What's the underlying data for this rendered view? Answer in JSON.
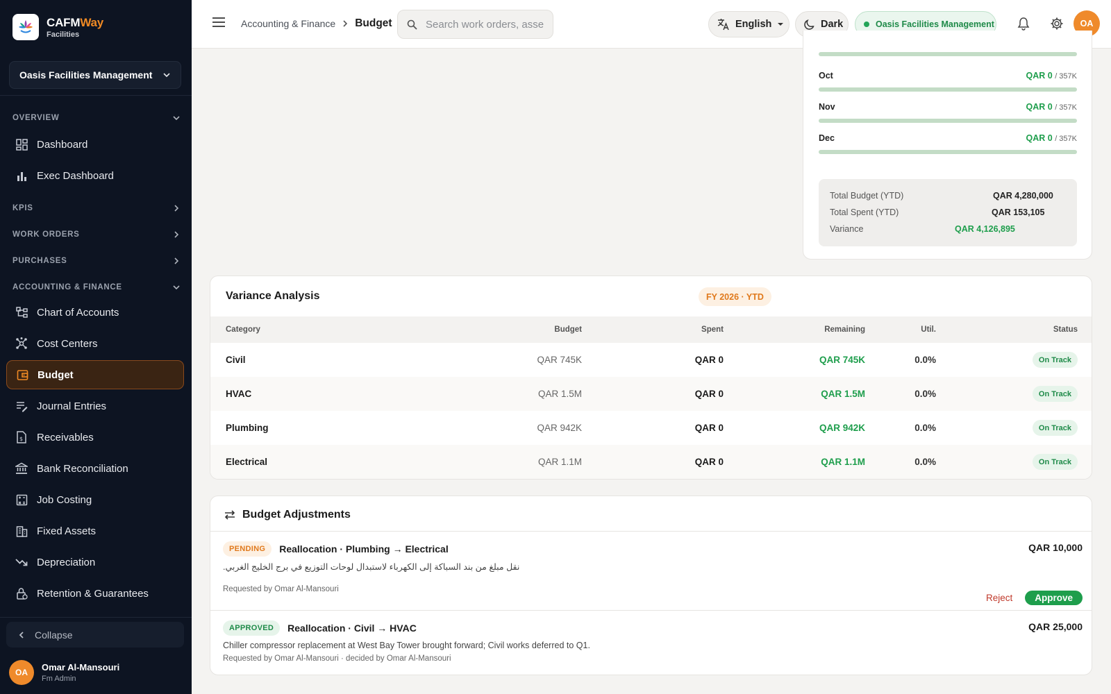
{
  "brand": {
    "name_part1": "CAFM",
    "name_part2": "Way",
    "subtitle": "Facilities"
  },
  "sidebar": {
    "org": "Oasis Facilities Management",
    "sections": {
      "overview": "OVERVIEW",
      "kpis": "KPIS",
      "work_orders": "WORK ORDERS",
      "purchases": "PURCHASES",
      "accounting": "ACCOUNTING & FINANCE"
    },
    "items": {
      "dashboard": "Dashboard",
      "exec_dashboard": "Exec Dashboard",
      "chart_of_accounts": "Chart of Accounts",
      "cost_centers": "Cost Centers",
      "budget": "Budget",
      "journal_entries": "Journal Entries",
      "receivables": "Receivables",
      "bank_reconciliation": "Bank Reconciliation",
      "job_costing": "Job Costing",
      "fixed_assets": "Fixed Assets",
      "depreciation": "Depreciation",
      "retention": "Retention & Guarantees"
    },
    "collapse": "Collapse",
    "user": {
      "initials": "OA",
      "name": "Omar Al-Mansouri",
      "role": "Fm Admin"
    }
  },
  "header": {
    "breadcrumb_parent": "Accounting & Finance",
    "breadcrumb_current": "Budget",
    "search_placeholder": "Search work orders, assets...",
    "language": "English",
    "theme": "Dark",
    "org_status": "Oasis Facilities Management",
    "avatar_initials": "OA"
  },
  "monthly": {
    "first_bar_fill": 0,
    "months": [
      {
        "name": "Oct",
        "spent": "QAR 0",
        "budget": "/ 357K",
        "fill": 0
      },
      {
        "name": "Nov",
        "spent": "QAR 0",
        "budget": "/ 357K",
        "fill": 0
      },
      {
        "name": "Dec",
        "spent": "QAR 0",
        "budget": "/ 357K",
        "fill": 0
      }
    ],
    "summary": {
      "total_budget_label": "Total Budget (YTD)",
      "total_budget_value": "QAR 4,280,000",
      "total_spent_label": "Total Spent (YTD)",
      "total_spent_value": "QAR 153,105",
      "variance_label": "Variance",
      "variance_value": "QAR 4,126,895"
    }
  },
  "variance": {
    "title": "Variance Analysis",
    "badge": "FY 2026 · YTD",
    "columns": {
      "category": "Category",
      "budget": "Budget",
      "spent": "Spent",
      "remaining": "Remaining",
      "util": "Util.",
      "status": "Status"
    },
    "rows": [
      {
        "category": "Civil",
        "budget": "QAR 745K",
        "spent": "QAR 0",
        "remaining": "QAR 745K",
        "util": "0.0%",
        "status": "On Track"
      },
      {
        "category": "HVAC",
        "budget": "QAR 1.5M",
        "spent": "QAR 0",
        "remaining": "QAR 1.5M",
        "util": "0.0%",
        "status": "On Track"
      },
      {
        "category": "Plumbing",
        "budget": "QAR 942K",
        "spent": "QAR 0",
        "remaining": "QAR 942K",
        "util": "0.0%",
        "status": "On Track"
      },
      {
        "category": "Electrical",
        "budget": "QAR 1.1M",
        "spent": "QAR 0",
        "remaining": "QAR 1.1M",
        "util": "0.0%",
        "status": "On Track"
      }
    ]
  },
  "adjustments": {
    "title": "Budget Adjustments",
    "items": [
      {
        "status": "PENDING",
        "title": "Reallocation · Plumbing → Electrical",
        "amount": "QAR 10,000",
        "note": "نقل مبلغ من بند السباكة إلى الكهرباء لاستبدال لوحات التوزيع في برج الخليج الغربي.",
        "meta": "Requested by Omar Al-Mansouri",
        "reject": "Reject",
        "approve": "Approve"
      },
      {
        "status": "APPROVED",
        "title": "Reallocation · Civil → HVAC",
        "amount": "QAR 25,000",
        "note": "Chiller compressor replacement at West Bay Tower brought forward; Civil works deferred to Q1.",
        "meta": "Requested by Omar Al-Mansouri · decided by Omar Al-Mansouri"
      }
    ]
  },
  "colors": {
    "accent": "#ef8a2b",
    "success": "#1e9e4c",
    "sidebar_bg": "#0d1422"
  }
}
